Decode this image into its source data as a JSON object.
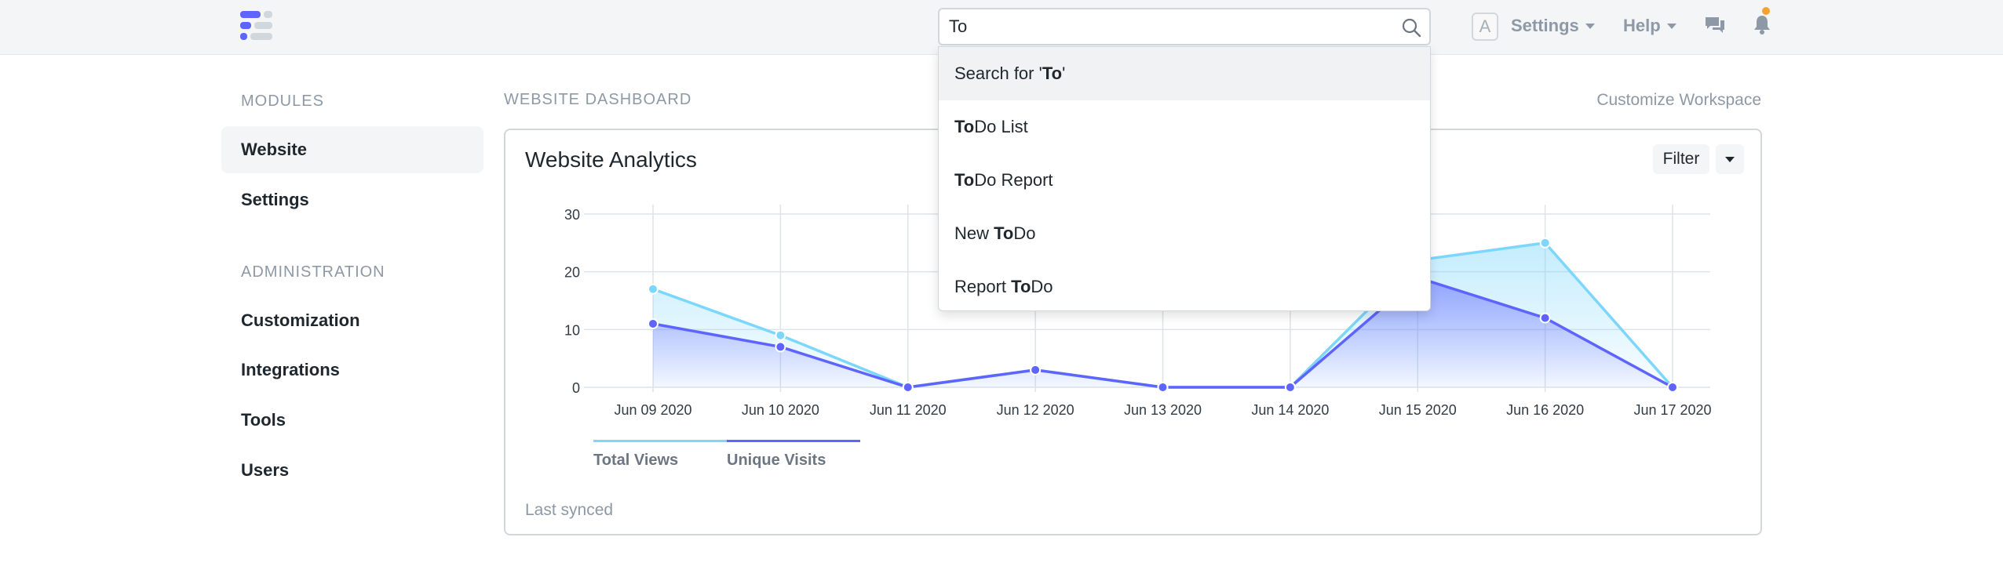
{
  "navbar": {
    "search": {
      "value": "To",
      "placeholder": ""
    },
    "avatar_letter": "A",
    "settings_label": "Settings",
    "help_label": "Help",
    "colors": {
      "brand": "#5e64ff",
      "notification_dot": "#f8a12f"
    }
  },
  "search_results": [
    {
      "prefix": "Search for '",
      "match": "To",
      "suffix": "'"
    },
    {
      "prefix": "",
      "match": "To",
      "suffix": "Do List"
    },
    {
      "prefix": "",
      "match": "To",
      "suffix": "Do Report"
    },
    {
      "prefix": "New ",
      "match": "To",
      "suffix": "Do"
    },
    {
      "prefix": "Report ",
      "match": "To",
      "suffix": "Do"
    }
  ],
  "sidebar": {
    "modules_heading": "MODULES",
    "modules": [
      {
        "label": "Website"
      },
      {
        "label": "Settings"
      }
    ],
    "admin_heading": "ADMINISTRATION",
    "admin": [
      {
        "label": "Customization"
      },
      {
        "label": "Integrations"
      },
      {
        "label": "Tools"
      },
      {
        "label": "Users"
      }
    ]
  },
  "main": {
    "page_label": "WEBSITE DASHBOARD",
    "customize_label": "Customize Workspace",
    "card": {
      "title": "Website Analytics",
      "filter_label": "Filter",
      "last_synced": "Last synced"
    }
  },
  "chart_data": {
    "type": "area",
    "title": "",
    "categories": [
      "Jun 09 2020",
      "Jun 10 2020",
      "Jun 11 2020",
      "Jun 12 2020",
      "Jun 13 2020",
      "Jun 14 2020",
      "Jun 15 2020",
      "Jun 16 2020",
      "Jun 17 2020"
    ],
    "y_ticks": [
      "0",
      "10",
      "20",
      "30"
    ],
    "ylim": [
      0,
      30
    ],
    "grid": true,
    "legend_position": "bottom-left",
    "series": [
      {
        "name": "Total Views",
        "color": "#7cd6fd",
        "values": [
          17,
          9,
          0,
          3,
          0,
          0,
          22,
          25,
          0
        ]
      },
      {
        "name": "Unique Visits",
        "color": "#5e64ff",
        "values": [
          11,
          7,
          0,
          3,
          0,
          0,
          19,
          12,
          0
        ]
      }
    ]
  }
}
